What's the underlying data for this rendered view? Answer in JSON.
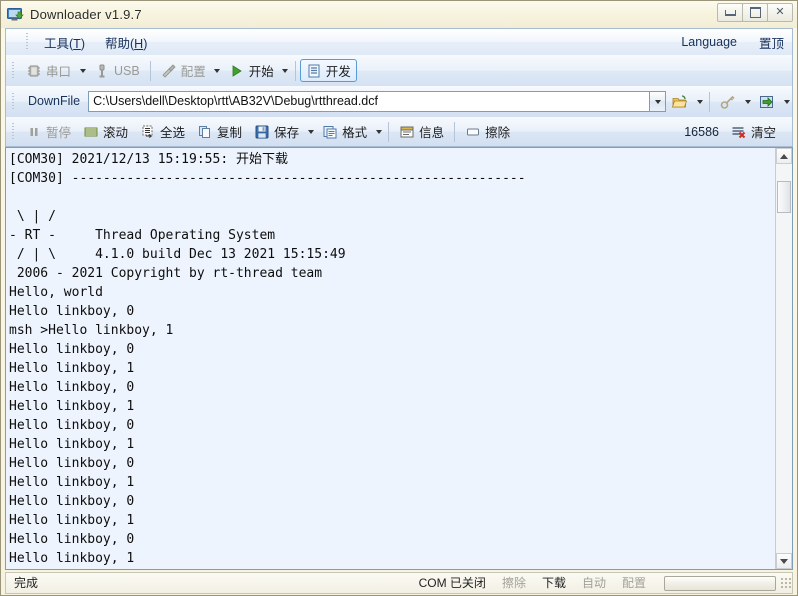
{
  "window": {
    "title": "Downloader v1.9.7",
    "icon": "downloader-monitor-icon",
    "buttons": {
      "minimize": "minimize-icon",
      "maximize": "maximize-icon",
      "close": "✕"
    }
  },
  "menubar": {
    "items": [
      {
        "name": "tools",
        "pre": "工具(",
        "key": "T",
        "post": ")"
      },
      {
        "name": "help",
        "pre": "帮助(",
        "key": "H",
        "post": ")"
      }
    ],
    "right": [
      {
        "name": "language",
        "label": "Language"
      },
      {
        "name": "always-on-top",
        "label": "置顶"
      }
    ]
  },
  "toolbar": {
    "items": [
      {
        "name": "serial-port",
        "label": "串口",
        "icon": "chip-icon",
        "disabled": true,
        "dropdown": true
      },
      {
        "name": "usb",
        "label": "USB",
        "icon": "usb-icon",
        "disabled": true,
        "dropdown": false
      },
      {
        "name": "config",
        "label": "配置",
        "icon": "tools-icon",
        "disabled": true,
        "dropdown": true
      },
      {
        "name": "start",
        "label": "开始",
        "icon": "play-icon",
        "disabled": false,
        "dropdown": true
      },
      {
        "name": "develop",
        "label": "开发",
        "icon": "document-icon",
        "disabled": false,
        "selected": true
      }
    ]
  },
  "downfile": {
    "label": "DownFile",
    "path": "C:\\Users\\dell\\Desktop\\rtt\\AB32V\\Debug\\rtthread.dcf",
    "placeholder": "",
    "actions": [
      {
        "name": "open-folder",
        "icon": "folder-open-icon",
        "dropdown": true
      },
      {
        "name": "key",
        "icon": "key-icon",
        "dropdown": true
      },
      {
        "name": "import",
        "icon": "import-arrow-icon",
        "dropdown": true
      }
    ]
  },
  "toolbar2": {
    "items": [
      {
        "name": "pause",
        "label": "暂停",
        "icon": "pause-icon",
        "disabled": true
      },
      {
        "name": "scroll",
        "label": "滚动",
        "icon": "scroll-icon",
        "disabled": false
      },
      {
        "name": "select-all",
        "label": "全选",
        "icon": "select-all-icon",
        "disabled": false
      },
      {
        "name": "copy",
        "label": "复制",
        "icon": "copy-icon",
        "disabled": false
      },
      {
        "name": "save",
        "label": "保存",
        "icon": "save-disk-icon",
        "disabled": false,
        "dropdown": true
      },
      {
        "name": "format",
        "label": "格式",
        "icon": "format-icon",
        "disabled": false,
        "dropdown": true
      },
      {
        "name": "info",
        "label": "信息",
        "icon": "info-window-icon",
        "disabled": false
      },
      {
        "name": "erase",
        "label": "擦除",
        "icon": "erase-box-icon",
        "disabled": false
      }
    ],
    "byte_count": "16586",
    "clear_label": "清空",
    "clear_icon": "clear-lines-red-x-icon"
  },
  "terminal": {
    "lines": [
      "[COM30] 2021/12/13 15:19:55: 开始下载",
      "[COM30] ----------------------------------------------------------",
      "",
      " \\ | /",
      "- RT -     Thread Operating System",
      " / | \\     4.1.0 build Dec 13 2021 15:15:49",
      " 2006 - 2021 Copyright by rt-thread team",
      "Hello, world",
      "Hello linkboy, 0",
      "msh >Hello linkboy, 1",
      "Hello linkboy, 0",
      "Hello linkboy, 1",
      "Hello linkboy, 0",
      "Hello linkboy, 1",
      "Hello linkboy, 0",
      "Hello linkboy, 1",
      "Hello linkboy, 0",
      "Hello linkboy, 1",
      "Hello linkboy, 0",
      "Hello linkboy, 1",
      "Hello linkboy, 0",
      "Hello linkboy, 1"
    ]
  },
  "statusbar": {
    "message": "完成",
    "com_status": "COM 已关闭",
    "flags": [
      {
        "name": "erase",
        "label": "擦除",
        "dim": true
      },
      {
        "name": "download",
        "label": "下载",
        "dim": false
      },
      {
        "name": "auto",
        "label": "自动",
        "dim": true
      },
      {
        "name": "config",
        "label": "配置",
        "dim": true
      }
    ],
    "progress_percent": 0
  },
  "colors": {
    "title_bg": "#f7f3df",
    "toolbar_blue": "#dfe9f6",
    "terminal_bg": "#edf4fd",
    "accent_border": "#5b9bd5",
    "menu_text": "#16315a"
  }
}
